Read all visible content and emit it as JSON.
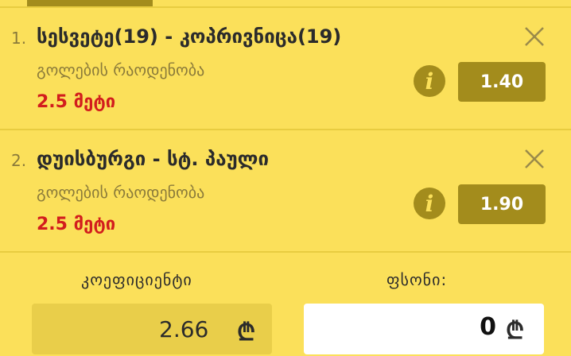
{
  "bets": [
    {
      "index": "1.",
      "match": "სესვეტე(19) - კოპრივნიცა(19)",
      "market": "გოლების რაოდენობა",
      "selection": "2.5 მეტი",
      "odds": "1.40",
      "info_icon": "i"
    },
    {
      "index": "2.",
      "match": "დუისბურგი - სტ. პაული",
      "market": "გოლების რაოდენობა",
      "selection": "2.5 მეტი",
      "odds": "1.90",
      "info_icon": "i"
    }
  ],
  "summary": {
    "coefficient_label": "კოეფიციენტი",
    "coefficient_value": "2.66",
    "stake_label": "ფსონი:",
    "stake_value": "0",
    "currency_symbol": "₾"
  },
  "colors": {
    "background": "#fbe05a",
    "accent": "#a38c1c",
    "selection_red": "#d21d1d"
  }
}
